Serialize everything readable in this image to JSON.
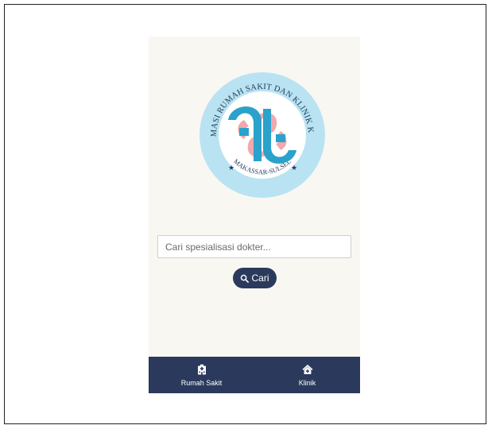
{
  "logo": {
    "ring_text_top": "LAYANAN INFORMASI RUMAH SAKIT DAN KLINIK KEC.TAMALANREA",
    "ring_text_bottom": "MAKASSAR-SULSEL",
    "star_glyph": "★",
    "icon": "medical-cross-logo-icon",
    "colors": {
      "ring": "#b9e3f2",
      "ring_text": "#1f3a5a",
      "blue": "#2aa2cc",
      "pink": "#f2a8ad"
    }
  },
  "search": {
    "placeholder": "Cari spesialisasi dokter...",
    "value": "",
    "button_label": "Cari",
    "button_icon": "search-icon"
  },
  "bottom_nav": {
    "items": [
      {
        "label": "Rumah Sakit",
        "icon": "hospital-icon"
      },
      {
        "label": "Klinik",
        "icon": "clinic-house-icon"
      }
    ]
  },
  "colors": {
    "nav_background": "#2b3a5c",
    "page_background": "#f9f7f2",
    "button_background": "#2b3a5c"
  }
}
